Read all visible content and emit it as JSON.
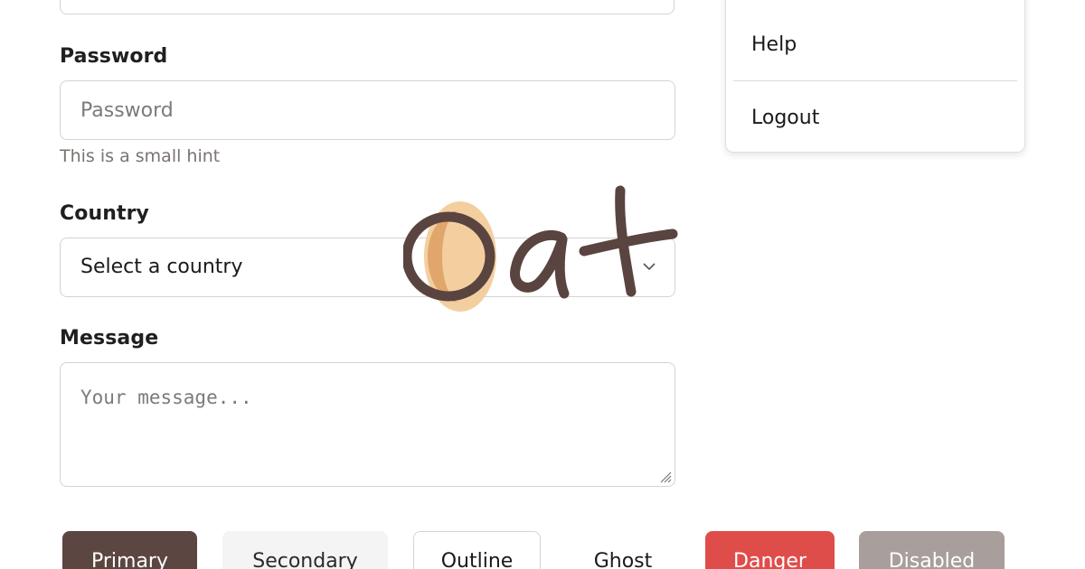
{
  "form": {
    "password": {
      "label": "Password",
      "placeholder": "Password",
      "hint": "This is a small hint"
    },
    "country": {
      "label": "Country",
      "selected": "Select a country"
    },
    "message": {
      "label": "Message",
      "placeholder": "Your message..."
    }
  },
  "buttons": {
    "primary": "Primary",
    "secondary": "Secondary",
    "outline": "Outline",
    "ghost": "Ghost",
    "danger": "Danger",
    "disabled": "Disabled"
  },
  "menu": {
    "items": [
      "Help",
      "Logout"
    ]
  },
  "logo": {
    "text": "oat",
    "colors": {
      "ink": "#5a4440",
      "accent_light": "#f3cfa0",
      "accent_dark": "#e0a66b"
    }
  },
  "colors": {
    "primary": "#5c4642",
    "danger": "#df4d4a",
    "disabled": "#a89e9c",
    "secondary": "#f4f4f4"
  },
  "icons": {
    "select_chevron": "chevron-down-icon",
    "resize": "resize-grip-icon"
  }
}
